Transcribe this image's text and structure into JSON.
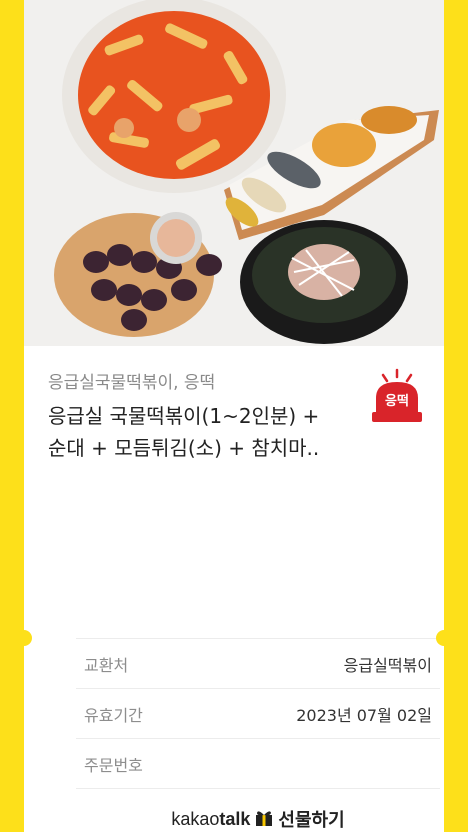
{
  "product": {
    "brand": "응급실국물떡볶이, 응떡",
    "name_line1": "응급실 국물떡볶이(1~2인분) +",
    "name_line2": "순대 + 모듬튀김(소) + 참치마..",
    "logo_text": "응떡"
  },
  "info": {
    "rows": [
      {
        "key": "교환처",
        "value": "응급실떡볶이"
      },
      {
        "key": "유효기간",
        "value": "2023년 07월 02일"
      },
      {
        "key": "주문번호",
        "value": ""
      }
    ]
  },
  "footer": {
    "kakao_light": "kakao",
    "kakao_bold": "talk",
    "gift": "선물하기"
  },
  "colors": {
    "background": "#fde01a",
    "card": "#ffffff",
    "logo_red": "#d9242a"
  }
}
